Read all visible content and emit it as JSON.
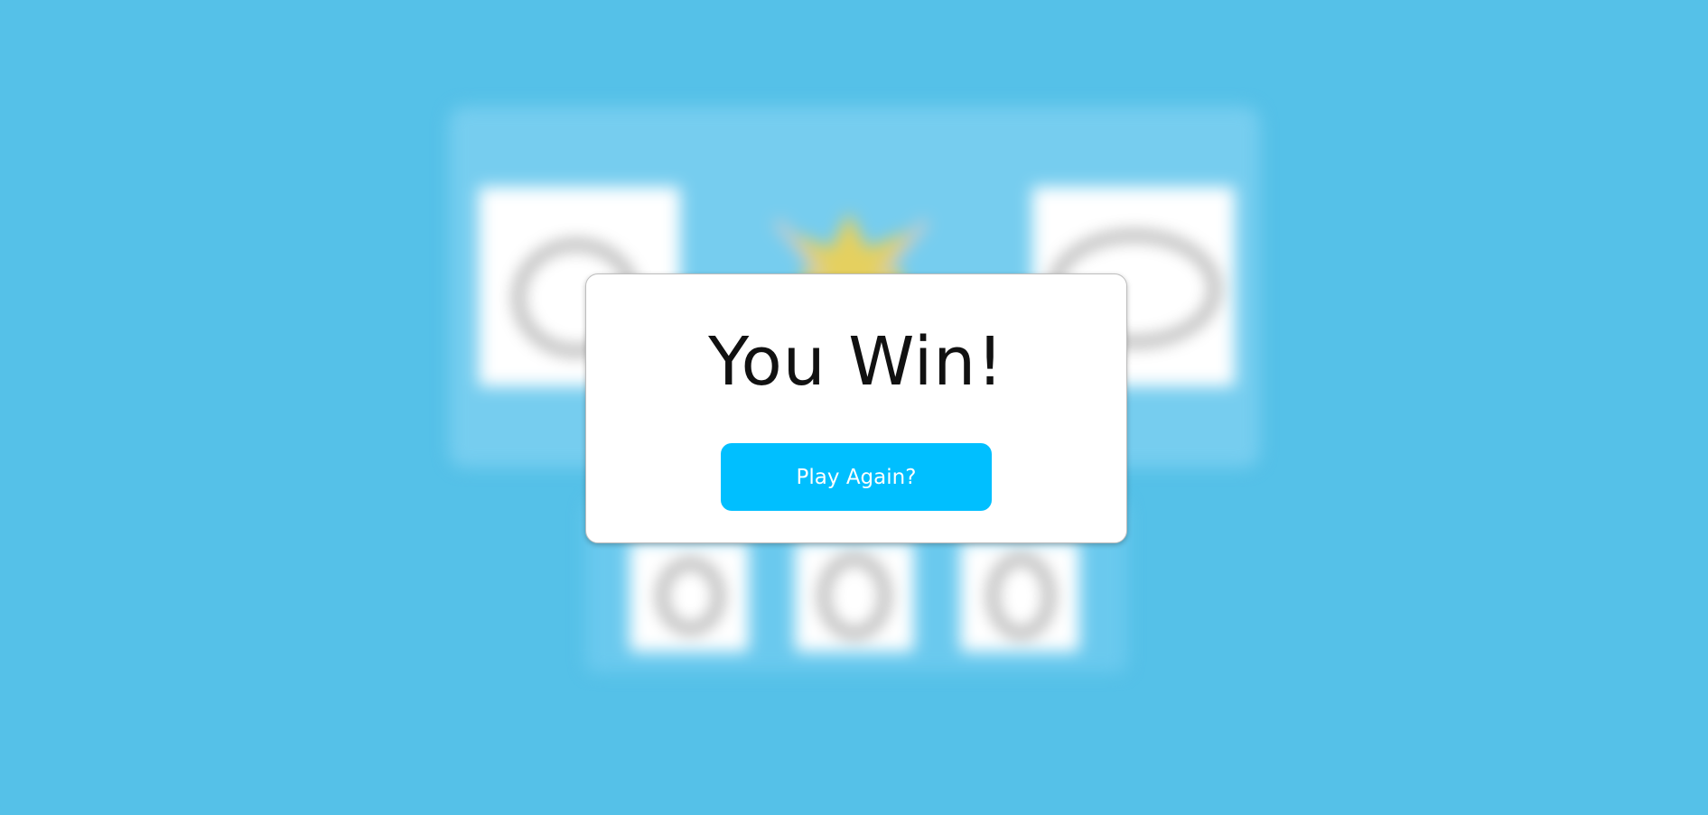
{
  "game": {
    "board_color": "#76cdef",
    "player_choice_icon": "rock-hand-icon",
    "computer_choice_icon": "scissors-hand-icon",
    "result_icon": "clash-burst-icon",
    "choices": [
      {
        "icon": "rock-hand-icon"
      },
      {
        "icon": "paper-hand-icon"
      },
      {
        "icon": "scissors-hand-icon"
      }
    ]
  },
  "result_modal": {
    "title": "You Win!",
    "play_again_label": "Play Again?",
    "button_color": "#00bfff"
  },
  "colors": {
    "background": "#55c1e8",
    "modal": "#ffffff"
  }
}
